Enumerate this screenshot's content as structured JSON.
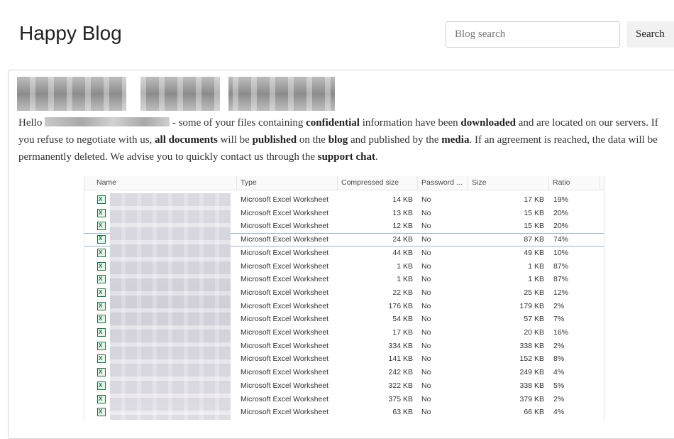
{
  "header": {
    "site_title": "Happy Blog",
    "search_placeholder": "Blog search",
    "search_button": "Search"
  },
  "post": {
    "body": {
      "hello": "Hello",
      "t1": " - some of your files containing ",
      "b1": "confidential",
      "t2": " information have been ",
      "b2": "downloaded",
      "t3": " and are located on our servers. If you refuse to negotiate with us, ",
      "b3": "all documents",
      "t4": " will be ",
      "b4": "published",
      "t5": " on the ",
      "b5": "blog",
      "t6": " and published by the ",
      "b6": "media",
      "t7": ". If an agreement is reached, the data will be permanently deleted. We advise you to quickly contact us through the ",
      "b7": "support chat",
      "t8": "."
    }
  },
  "archive": {
    "columns": [
      "Name",
      "Type",
      "Compressed size",
      "Password ...",
      "Size",
      "Ratio"
    ],
    "rows": [
      {
        "type": "Microsoft Excel Worksheet",
        "compressed": "14 KB",
        "password": "No",
        "size": "17 KB",
        "ratio": "19%"
      },
      {
        "type": "Microsoft Excel Worksheet",
        "compressed": "13 KB",
        "password": "No",
        "size": "15 KB",
        "ratio": "20%"
      },
      {
        "type": "Microsoft Excel Worksheet",
        "compressed": "12 KB",
        "password": "No",
        "size": "15 KB",
        "ratio": "20%"
      },
      {
        "type": "Microsoft Excel Worksheet",
        "compressed": "24 KB",
        "password": "No",
        "size": "87 KB",
        "ratio": "74%"
      },
      {
        "type": "Microsoft Excel Worksheet",
        "compressed": "44 KB",
        "password": "No",
        "size": "49 KB",
        "ratio": "10%"
      },
      {
        "type": "Microsoft Excel Worksheet",
        "compressed": "1 KB",
        "password": "No",
        "size": "1 KB",
        "ratio": "87%"
      },
      {
        "type": "Microsoft Excel Worksheet",
        "compressed": "1 KB",
        "password": "No",
        "size": "1 KB",
        "ratio": "87%"
      },
      {
        "type": "Microsoft Excel Worksheet",
        "compressed": "22 KB",
        "password": "No",
        "size": "25 KB",
        "ratio": "12%"
      },
      {
        "type": "Microsoft Excel Worksheet",
        "compressed": "176 KB",
        "password": "No",
        "size": "179 KB",
        "ratio": "2%"
      },
      {
        "type": "Microsoft Excel Worksheet",
        "compressed": "54 KB",
        "password": "No",
        "size": "57 KB",
        "ratio": "7%"
      },
      {
        "type": "Microsoft Excel Worksheet",
        "compressed": "17 KB",
        "password": "No",
        "size": "20 KB",
        "ratio": "16%"
      },
      {
        "type": "Microsoft Excel Worksheet",
        "compressed": "334 KB",
        "password": "No",
        "size": "338 KB",
        "ratio": "2%"
      },
      {
        "type": "Microsoft Excel Worksheet",
        "compressed": "141 KB",
        "password": "No",
        "size": "152 KB",
        "ratio": "8%"
      },
      {
        "type": "Microsoft Excel Worksheet",
        "compressed": "242 KB",
        "password": "No",
        "size": "249 KB",
        "ratio": "4%"
      },
      {
        "type": "Microsoft Excel Worksheet",
        "compressed": "322 KB",
        "password": "No",
        "size": "338 KB",
        "ratio": "5%"
      },
      {
        "type": "Microsoft Excel Worksheet",
        "compressed": "375 KB",
        "password": "No",
        "size": "379 KB",
        "ratio": "2%"
      },
      {
        "type": "Microsoft Excel Worksheet",
        "compressed": "63 KB",
        "password": "No",
        "size": "66 KB",
        "ratio": "4%"
      }
    ],
    "selected_row": 3,
    "icon": "excel-file-icon"
  }
}
